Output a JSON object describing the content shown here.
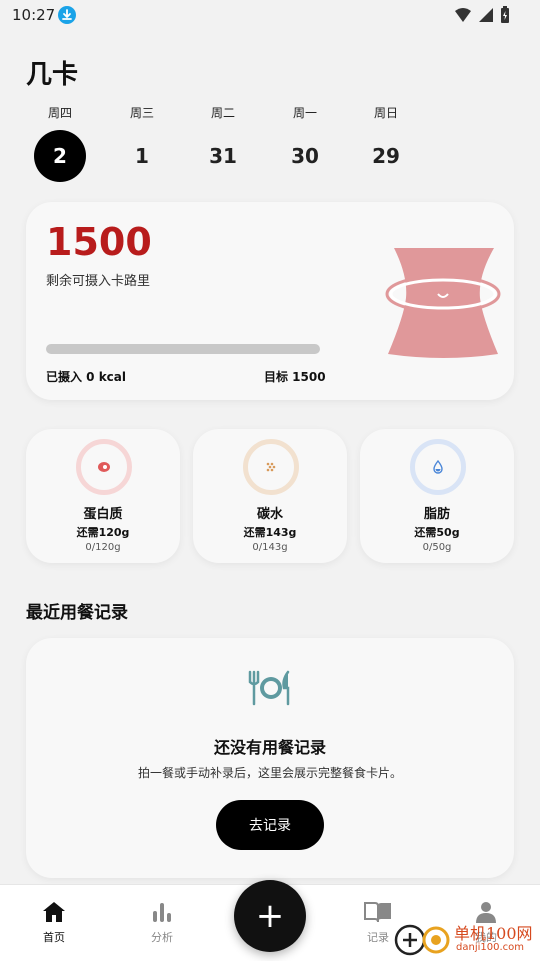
{
  "status": {
    "time": "10:27"
  },
  "app": {
    "title": "几卡"
  },
  "dates": [
    {
      "dow": "周四",
      "day": "2",
      "active": true
    },
    {
      "dow": "周三",
      "day": "1"
    },
    {
      "dow": "周二",
      "day": "31"
    },
    {
      "dow": "周一",
      "day": "30"
    },
    {
      "dow": "周日",
      "day": "29"
    }
  ],
  "calories": {
    "remaining": "1500",
    "remaining_label": "剩余可摄入卡路里",
    "intake_label": "已摄入 0 kcal",
    "target_label": "目标 1500",
    "progress_fraction": 0
  },
  "macros": [
    {
      "name": "蛋白质",
      "need": "还需120g",
      "progress": "0/120g",
      "color": "#e05a5a",
      "ring": "#f6d6d6"
    },
    {
      "name": "碳水",
      "need": "还需143g",
      "progress": "0/143g",
      "color": "#d89a5a",
      "ring": "#f2e1cf"
    },
    {
      "name": "脂肪",
      "need": "还需50g",
      "progress": "0/50g",
      "color": "#4a86d8",
      "ring": "#d9e4f6"
    }
  ],
  "recent": {
    "title": "最近用餐记录",
    "empty_title": "还没有用餐记录",
    "empty_desc": "拍一餐或手动补录后，这里会展示完整餐食卡片。",
    "button": "去记录"
  },
  "nav": {
    "items": [
      {
        "label": "首页",
        "icon": "home-icon"
      },
      {
        "label": "分析",
        "icon": "bar-chart-icon"
      },
      {
        "label": "记录",
        "icon": "book-icon"
      },
      {
        "label": "我的",
        "icon": "person-icon"
      }
    ],
    "fab": "+"
  },
  "watermark": {
    "text": "单机100网",
    "sub": "danji100.com"
  }
}
